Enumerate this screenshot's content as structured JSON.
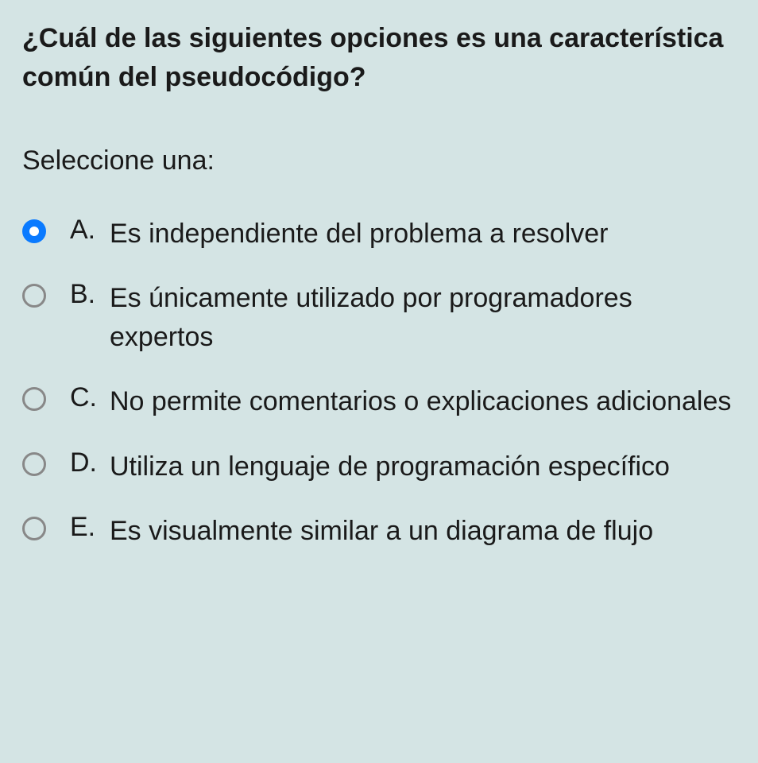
{
  "question": "¿Cuál de las siguientes opciones es una característica común del pseudocódigo?",
  "instruction": "Seleccione una:",
  "options": [
    {
      "letter": "A.",
      "text": "Es independiente del problema a resolver",
      "selected": true
    },
    {
      "letter": "B.",
      "text": "Es únicamente utilizado por programadores expertos",
      "selected": false
    },
    {
      "letter": "C.",
      "text": "No permite comentarios o explicaciones adicionales",
      "selected": false
    },
    {
      "letter": "D.",
      "text": "Utiliza un lenguaje de programación específico",
      "selected": false
    },
    {
      "letter": "E.",
      "text": "Es visualmente similar a un diagrama de flujo",
      "selected": false
    }
  ]
}
